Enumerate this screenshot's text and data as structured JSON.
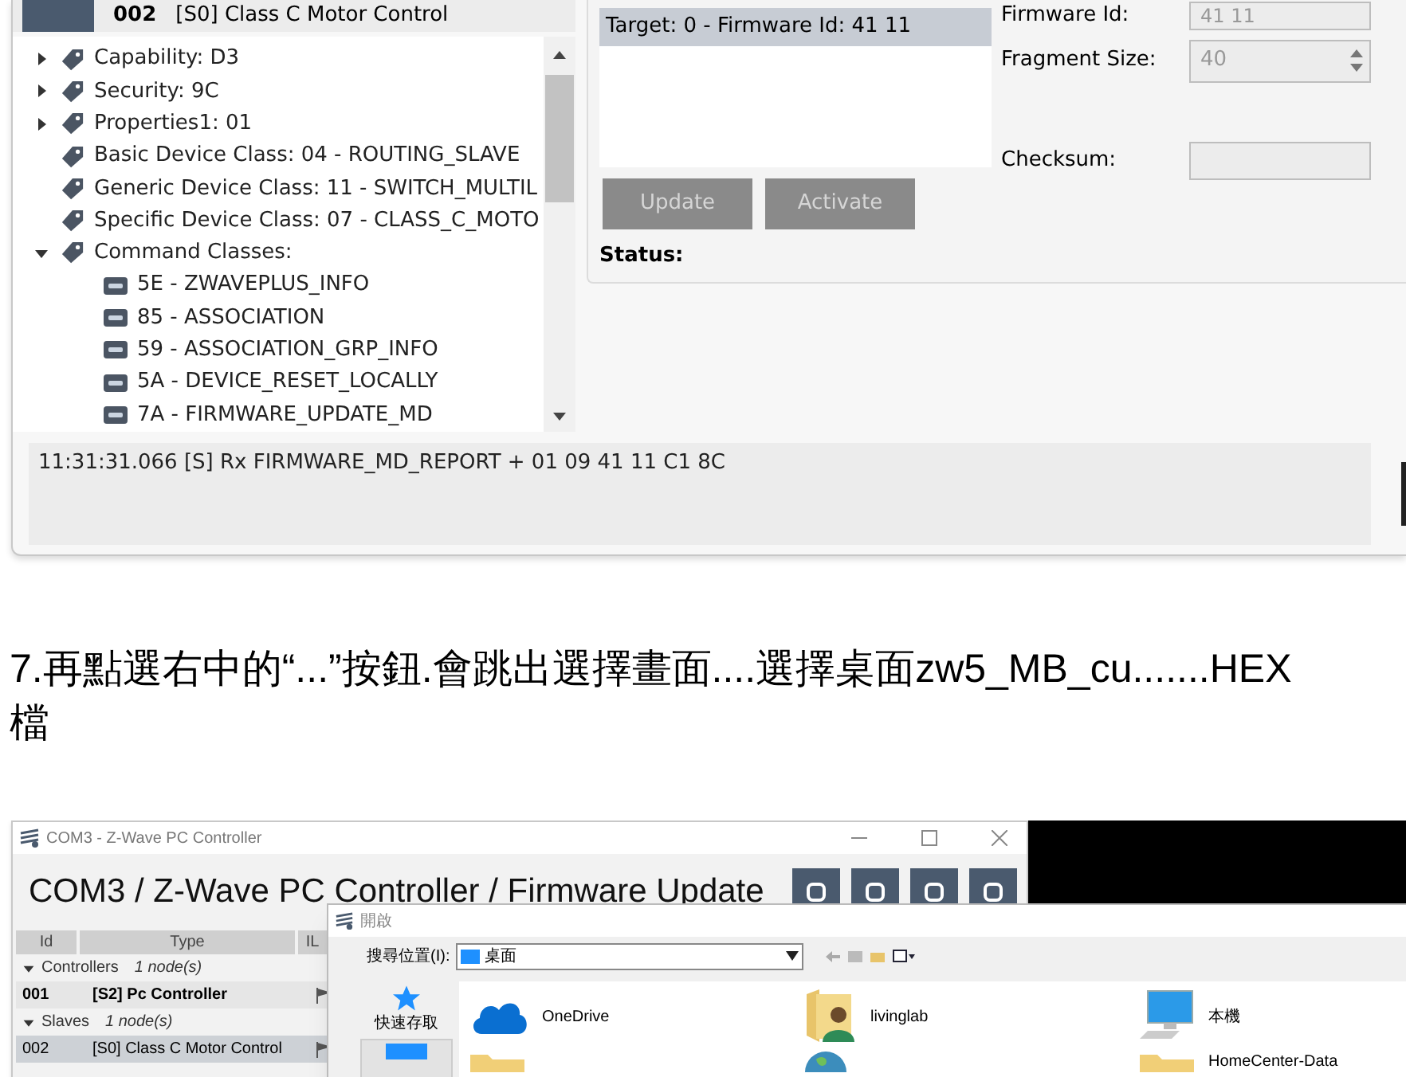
{
  "top_window": {
    "node_header": {
      "id": "002",
      "name": "[S0] Class C Motor Control"
    },
    "tree": [
      {
        "kind": "group",
        "label": "Capability: D3",
        "expanded": false
      },
      {
        "kind": "group",
        "label": "Security: 9C",
        "expanded": false
      },
      {
        "kind": "group",
        "label": "Properties1: 01",
        "expanded": false
      },
      {
        "kind": "leaf",
        "label": "Basic Device Class: 04 - ROUTING_SLAVE"
      },
      {
        "kind": "leaf",
        "label": "Generic Device Class: 11 - SWITCH_MULTIL"
      },
      {
        "kind": "leaf",
        "label": "Specific Device Class: 07 - CLASS_C_MOTO"
      },
      {
        "kind": "group",
        "label": "Command Classes:",
        "expanded": true,
        "children": [
          {
            "label": "5E - ZWAVEPLUS_INFO"
          },
          {
            "label": "85 - ASSOCIATION"
          },
          {
            "label": "59 - ASSOCIATION_GRP_INFO"
          },
          {
            "label": "5A - DEVICE_RESET_LOCALLY"
          },
          {
            "label": "7A - FIRMWARE_UPDATE_MD"
          }
        ]
      }
    ],
    "targets": [
      {
        "label": "Target: 0 - Firmware Id: 41 11",
        "selected": true
      }
    ],
    "firmware_id": {
      "label": "Firmware Id:",
      "value": "41 11"
    },
    "fragment_size": {
      "label": "Fragment Size:",
      "value": "40"
    },
    "checksum": {
      "label": "Checksum:"
    },
    "buttons": [
      {
        "label": "Update",
        "disabled": true
      },
      {
        "label": "Activate",
        "disabled": true
      }
    ],
    "status_label": "Status:",
    "log": [
      "11:31:31.066 [S] Rx FIRMWARE_MD_REPORT + 01 09 41 11 C1 8C"
    ]
  },
  "paragraph": [
    "7.再點選右中的“...”按鈕.會跳出選擇畫面....選擇桌面zw5_MB_cu.......HEX",
    "檔"
  ],
  "bottom_window": {
    "title": "COM3 - Z-Wave PC Controller",
    "heading": "COM3 / Z-Wave PC Controller / Firmware Update",
    "columns": [
      "Id",
      "Type",
      "IL"
    ],
    "groups": [
      {
        "label": "Controllers",
        "count": "1 node(s)",
        "expanded": true,
        "rows": [
          {
            "id": "001",
            "type": "[S2] Pc Controller",
            "selected": false
          }
        ]
      },
      {
        "label": "Slaves",
        "count": "1 node(s)",
        "expanded": true,
        "rows": [
          {
            "id": "002",
            "type": "[S0] Class C Motor Control",
            "selected": true
          }
        ]
      }
    ],
    "dialog": {
      "title": "開啟",
      "location_label": "搜尋位置(I):",
      "location": "桌面",
      "sidebar": [
        {
          "kind": "star",
          "label": "快速存取",
          "selected": false
        },
        {
          "kind": "desktop",
          "selected": true
        }
      ],
      "items": [
        {
          "kind": "cloud",
          "label": "OneDrive"
        },
        {
          "kind": "user-folder",
          "label": "livinglab"
        },
        {
          "kind": "computer",
          "label": "本機"
        },
        {
          "kind": "folder"
        },
        {
          "kind": "globe"
        },
        {
          "kind": "folder",
          "label": "HomeCenter-Data"
        }
      ]
    }
  }
}
